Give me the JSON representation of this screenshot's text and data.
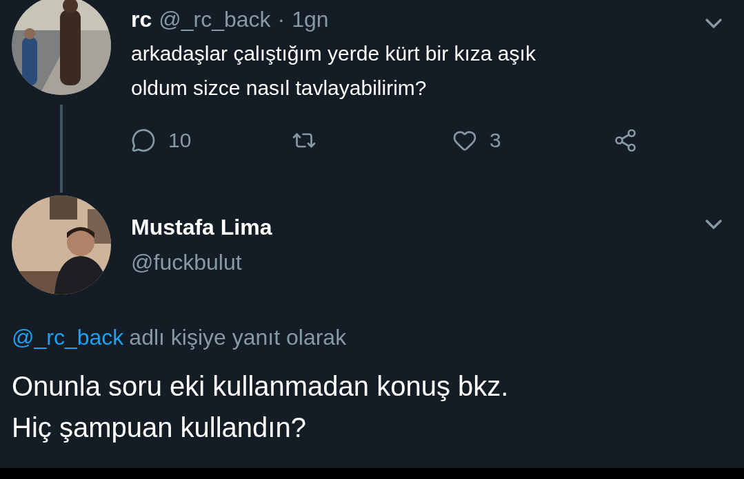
{
  "tweet": {
    "name": "rc",
    "handle": "@_rc_back",
    "separator": "·",
    "time": "1gn",
    "text": "arkadaşlar çalıştığım yerde kürt bir kıza aşık\noldum sizce nasıl tavlayabilirim?",
    "actions": [
      {
        "kind": "reply",
        "count": "10"
      },
      {
        "kind": "retweet"
      },
      {
        "kind": "like",
        "count": "3"
      },
      {
        "kind": "share"
      }
    ]
  },
  "reply": {
    "name": "Mustafa Lima",
    "handle": "@fuckbulut",
    "mention": "@_rc_back",
    "replying_to": "adlı kişiye yanıt olarak",
    "text": "Onunla soru eki kullanmadan konuş bkz.\nHiç şampuan kullandın?"
  }
}
